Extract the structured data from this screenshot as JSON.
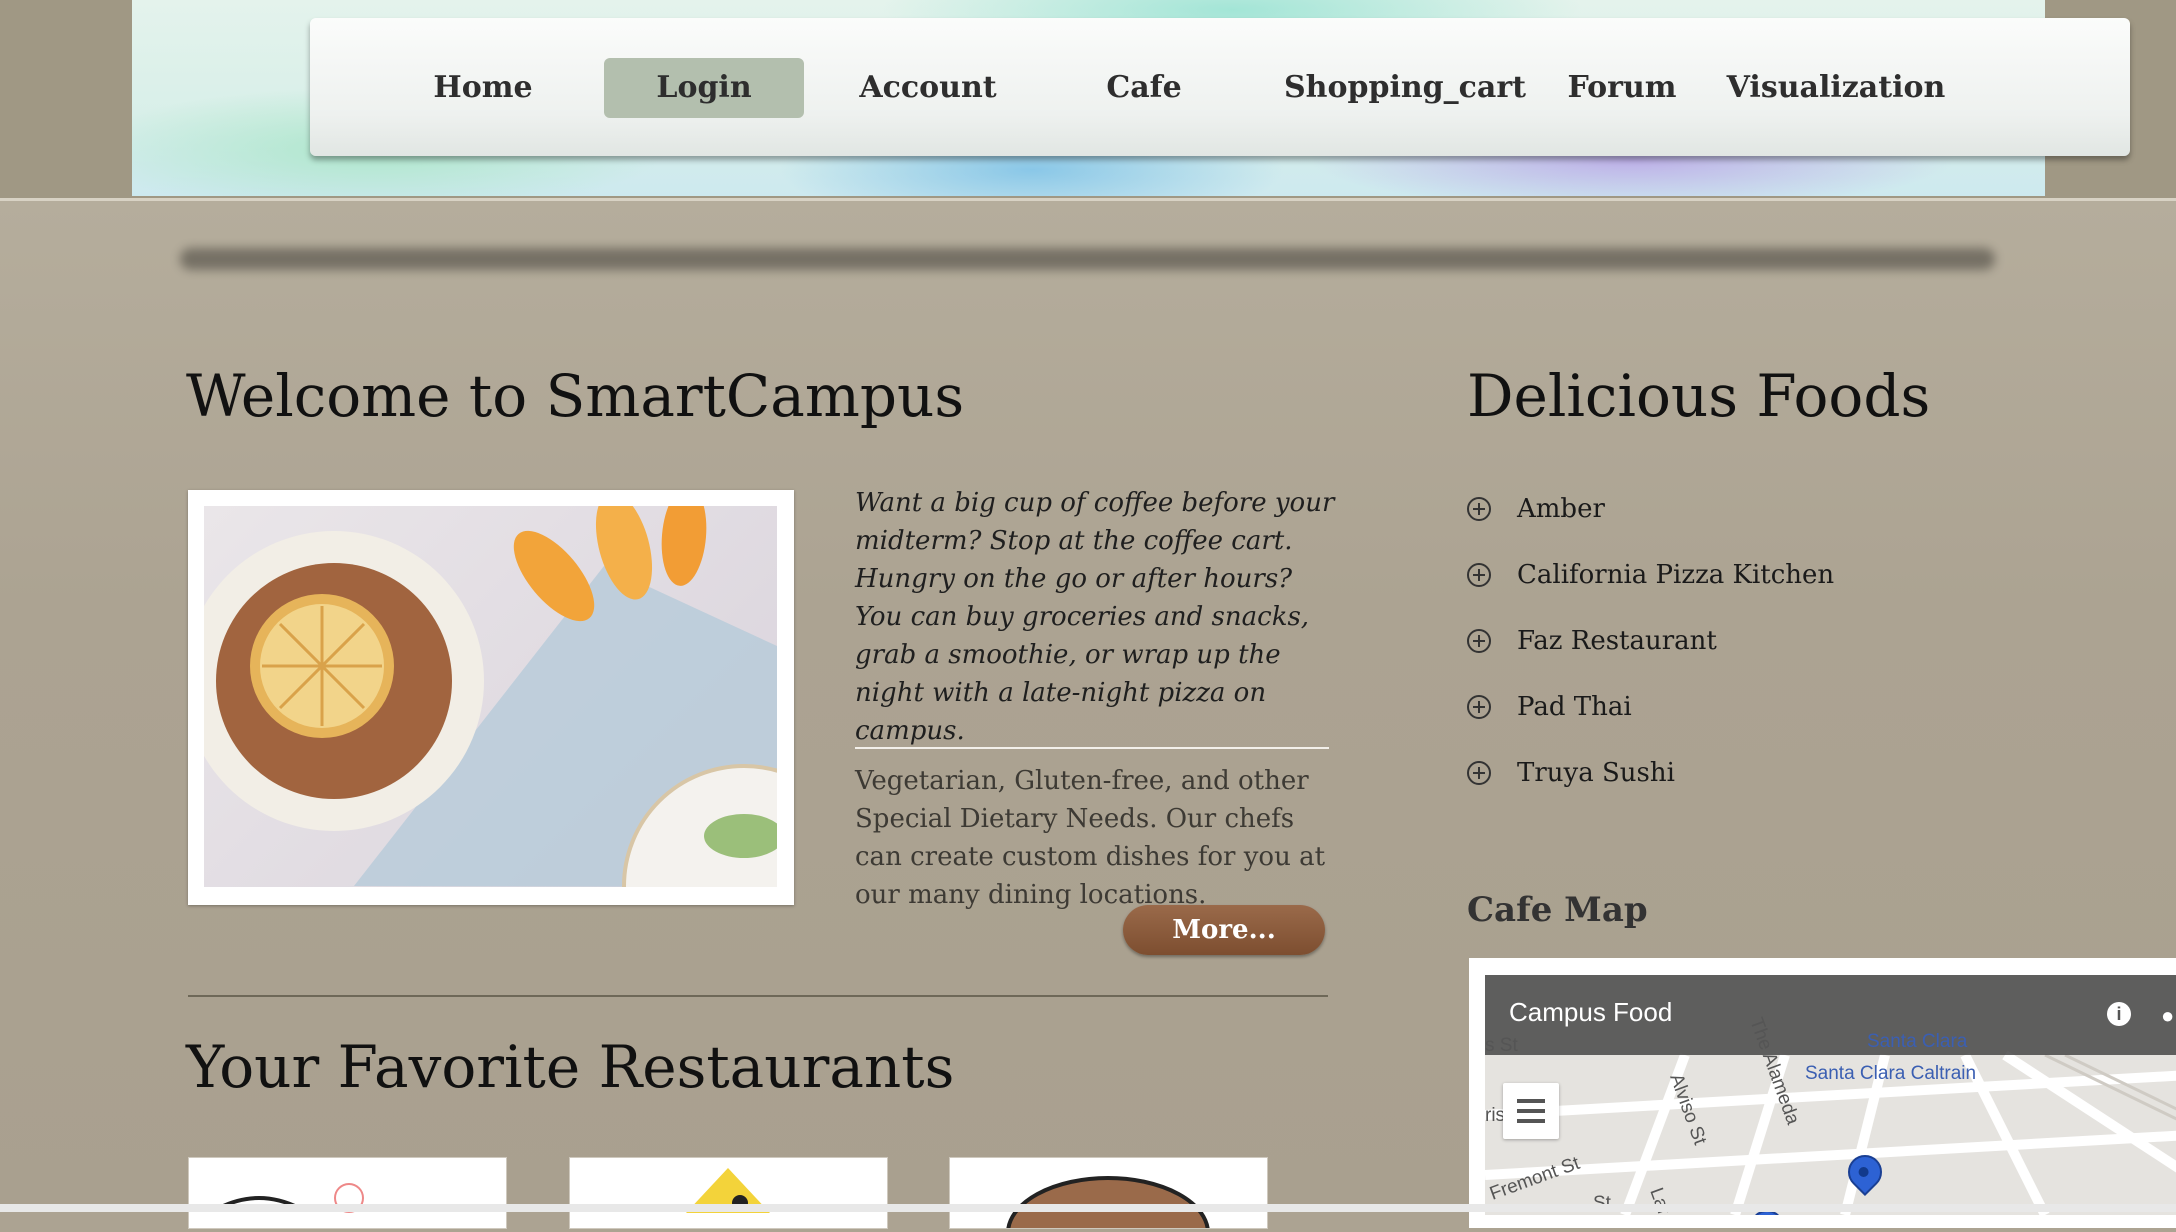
{
  "nav": {
    "items": [
      {
        "label": "Home"
      },
      {
        "label": "Login"
      },
      {
        "label": "Account"
      },
      {
        "label": "Cafe"
      },
      {
        "label": "Shopping_cart"
      },
      {
        "label": "Forum"
      },
      {
        "label": "Visualization"
      }
    ],
    "active": "Login"
  },
  "main": {
    "welcome_title": "Welcome to SmartCampus",
    "intro_italic": "Want a big cup of coffee before your midterm? Stop at the coffee cart. Hungry on the go or after hours? You can buy groceries and snacks, grab a smoothie, or wrap up the night with a late-night pizza on campus.",
    "intro_plain": "Vegetarian, Gluten-free, and other Special Dietary Needs. Our chefs can create custom dishes for you at our many dining locations.",
    "more_label": "More...",
    "favorites_title": "Your Favorite Restaurants"
  },
  "sidebar": {
    "foods_title": "Delicious Foods",
    "foods": [
      {
        "label": "Amber"
      },
      {
        "label": "California Pizza Kitchen"
      },
      {
        "label": "Faz Restaurant"
      },
      {
        "label": "Pad Thai"
      },
      {
        "label": "Truya Sushi"
      }
    ],
    "cafe_map_title": "Cafe Map",
    "map": {
      "title": "Campus Food",
      "labels": {
        "santa_clara": "Santa Clara",
        "caltrain": "Santa Clara Caltrain",
        "alviso": "Alviso St",
        "alameda": "The Alameda",
        "fremont": "Fremont St",
        "laf": "Laf",
        "st1": "s St",
        "st2": "St",
        "ris": "ris"
      }
    }
  },
  "colors": {
    "background": "#aca392",
    "nav_active": "#b3bfae",
    "more_button": "#7d4e30"
  }
}
